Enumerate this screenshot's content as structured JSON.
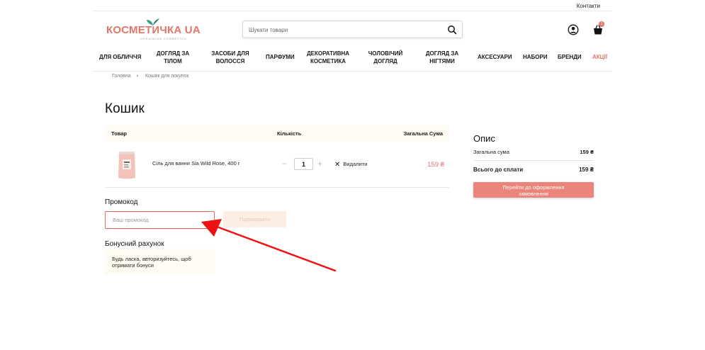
{
  "topbar": {
    "contacts": "Контакти"
  },
  "logo": {
    "brand": "КОСМЕТИЧКА UA",
    "tagline": "UKRAINIAN COSMETICS"
  },
  "search": {
    "placeholder": "Шукати товари"
  },
  "header": {
    "cart_count": "1"
  },
  "nav": {
    "face": "Для обличчя",
    "body_1": "Догляд за",
    "body_2": "тілом",
    "hair_1": "Засоби для",
    "hair_2": "волосся",
    "perfume": "Парфуми",
    "decor_1": "Декоративна",
    "decor_2": "косметика",
    "men_1": "Чоловічий",
    "men_2": "догляд",
    "nails_1": "Догляд за",
    "nails_2": "нігтями",
    "accessories": "Аксесуари",
    "sets": "Набори",
    "brands": "Бренди",
    "sale": "Акції"
  },
  "breadcrumb": {
    "home": "Головна",
    "sep": "›",
    "current": "Кошик для покупок"
  },
  "page": {
    "title": "Кошик"
  },
  "cart": {
    "headers": {
      "product": "Товар",
      "quantity": "Кількість",
      "total": "Загальна Сума"
    },
    "items": [
      {
        "name": "Сіль для ванни Sia Wild Rose, 400 г",
        "qty": "1",
        "price": "159 ₴",
        "remove": "Видалити",
        "minus": "−",
        "plus": "+",
        "remove_x": "✕"
      }
    ]
  },
  "summary": {
    "title": "Опис",
    "subtotal_label": "Загальна сума",
    "subtotal_value": "159 ₴",
    "total_label": "Всього до сплати",
    "total_value": "159 ₴",
    "checkout_1": "Перейти до оформлення",
    "checkout_2": "замовлення"
  },
  "promo": {
    "title": "Промокод",
    "placeholder": "Ваш промокод",
    "apply": "Підтвердити"
  },
  "bonus": {
    "title": "Бонусний рахунок",
    "text_1": "Будь ласка, авторизуйтесь, щоб",
    "text_2": "отримати бонуси"
  },
  "colors": {
    "accent": "#e0766a",
    "checkout": "#eb857b",
    "arrow": "#ee1111",
    "pale": "#fefcf2"
  }
}
